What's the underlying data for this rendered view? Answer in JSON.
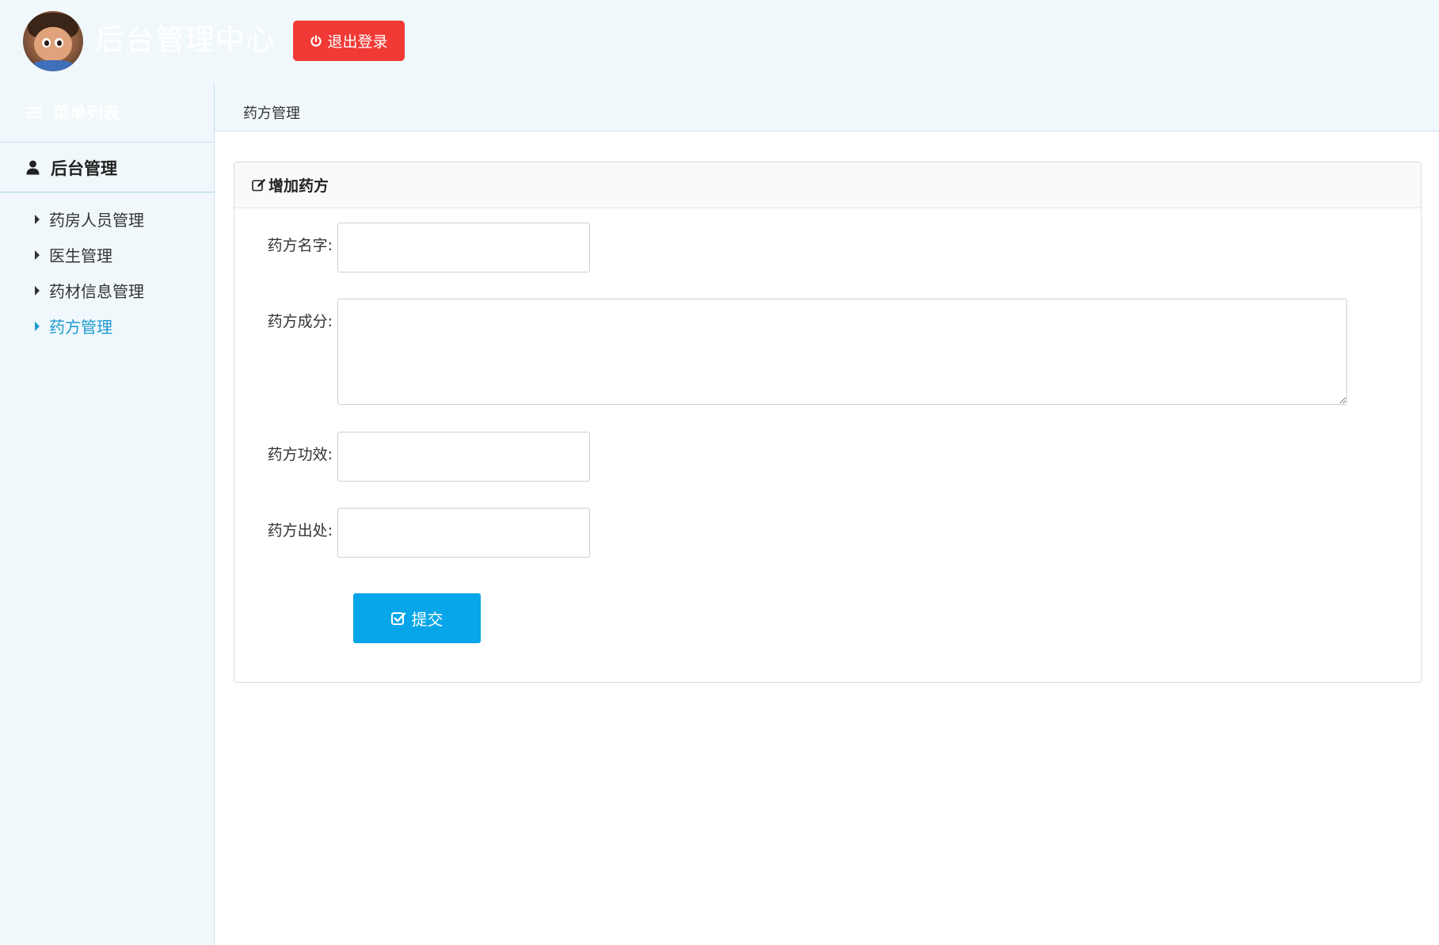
{
  "header": {
    "title": "后台管理中心",
    "logout_label": "退出登录"
  },
  "sidebar": {
    "menu_title": "菜单列表",
    "group_label": "后台管理",
    "items": [
      {
        "label": "药房人员管理",
        "active": false
      },
      {
        "label": "医生管理",
        "active": false
      },
      {
        "label": "药材信息管理",
        "active": false
      },
      {
        "label": "药方管理",
        "active": true
      }
    ]
  },
  "tabs": [
    {
      "label": "药方管理"
    }
  ],
  "panel": {
    "title": "增加药方"
  },
  "form": {
    "name_label": "药方名字:",
    "name_value": "",
    "ingredients_label": "药方成分:",
    "ingredients_value": "",
    "efficacy_label": "药方功效:",
    "efficacy_value": "",
    "source_label": "药方出处:",
    "source_value": "",
    "submit_label": "提交"
  },
  "colors": {
    "background": "#f0f8fb",
    "logout_button": "#f13a36",
    "submit_button": "#06a6e8",
    "active_nav": "#1e9ad0"
  },
  "icons": {
    "logout": "power-icon",
    "menu": "bars-icon",
    "group": "user-icon",
    "panel": "edit-icon",
    "submit": "check-square-icon",
    "nav_item": "caret-right-icon"
  }
}
